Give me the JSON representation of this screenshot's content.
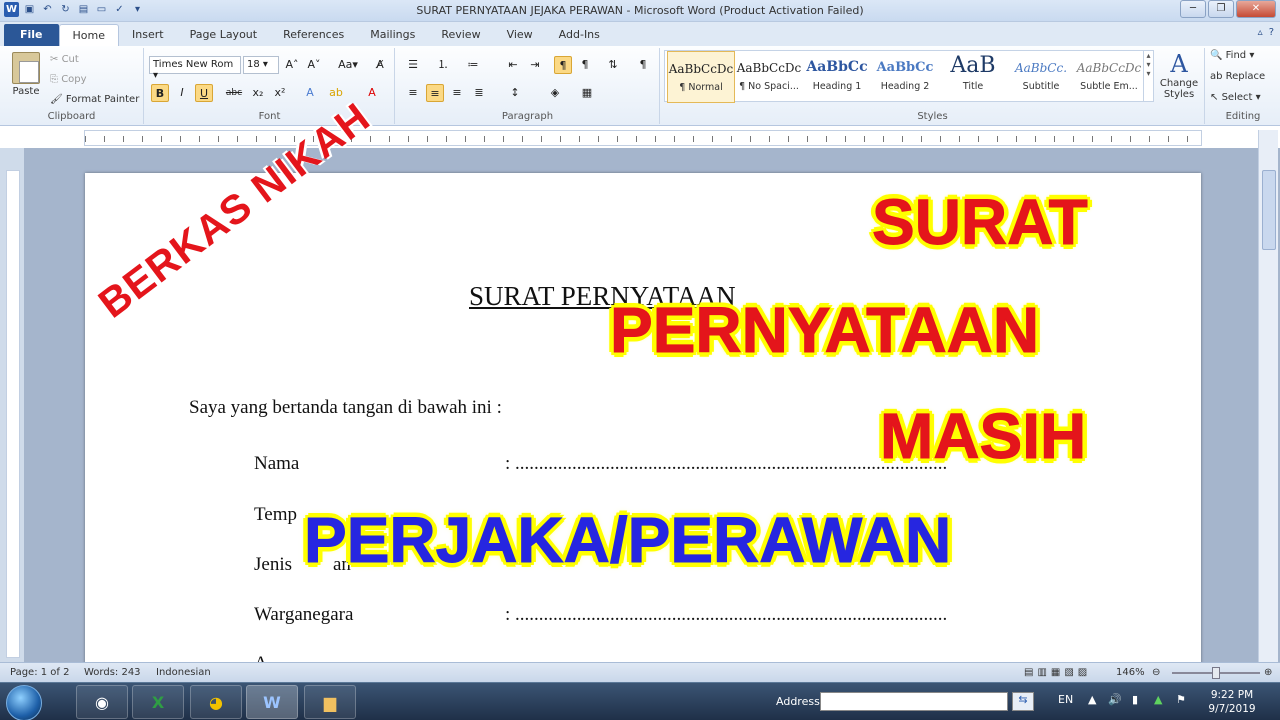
{
  "window": {
    "title": "SURAT PERNYATAAN JEJAKA  PERAWAN  -  Microsoft Word (Product Activation Failed)"
  },
  "tabs": [
    "File",
    "Home",
    "Insert",
    "Page Layout",
    "References",
    "Mailings",
    "Review",
    "View",
    "Add-Ins"
  ],
  "active_tab": "Home",
  "ribbon": {
    "clipboard": {
      "paste": "Paste",
      "cut": "Cut",
      "copy": "Copy",
      "format_painter": "Format Painter",
      "label": "Clipboard"
    },
    "font": {
      "name": "Times New Rom",
      "size": "18",
      "label": "Font",
      "bold": "B",
      "italic": "I",
      "underline": "U",
      "strike": "abc",
      "sub": "x₂",
      "sup": "x²"
    },
    "paragraph": {
      "label": "Paragraph"
    },
    "styles": {
      "label": "Styles",
      "items": [
        {
          "sample": "AaBbCcDc",
          "name": "¶ Normal"
        },
        {
          "sample": "AaBbCcDc",
          "name": "¶ No Spaci..."
        },
        {
          "sample": "AaBbCc",
          "name": "Heading 1"
        },
        {
          "sample": "AaBbCc",
          "name": "Heading 2"
        },
        {
          "sample": "AaB",
          "name": "Title"
        },
        {
          "sample": "AaBbCc.",
          "name": "Subtitle"
        },
        {
          "sample": "AaBbCcDc",
          "name": "Subtle Em..."
        }
      ],
      "change_styles": "Change Styles"
    },
    "editing": {
      "find": "Find",
      "replace": "Replace",
      "select": "Select",
      "label": "Editing"
    }
  },
  "document": {
    "title": "SURAT PERNYATAAN",
    "intro": "Saya yang bertanda tangan di bawah ini :",
    "fields": [
      {
        "label": "Nama",
        "value": ":  ..........................................................................................."
      },
      {
        "label": "Temp",
        "value": "."
      },
      {
        "label": "Jenis",
        "value": "an"
      },
      {
        "label": "Warganegara",
        "value": ":  ..........................................................................................."
      }
    ],
    "next_line_partial": "A"
  },
  "overlay": {
    "diagonal": "BERKAS NIKAH",
    "line1": "SURAT",
    "line2": "PERNYATAAN",
    "line3": "MASIH",
    "line4": "PERJAKA/PERAWAN"
  },
  "statusbar": {
    "page": "Page: 1 of 2",
    "words": "Words: 243",
    "language": "Indonesian",
    "zoom": "146%"
  },
  "taskbar": {
    "address_label": "Address",
    "lang": "EN",
    "time": "9:22 PM",
    "date": "9/7/2019"
  },
  "colors": {
    "overlay_red": "#e4151b",
    "overlay_blue": "#2626e0",
    "overlay_glow": "#ffff00",
    "file_tab": "#2b5797"
  }
}
